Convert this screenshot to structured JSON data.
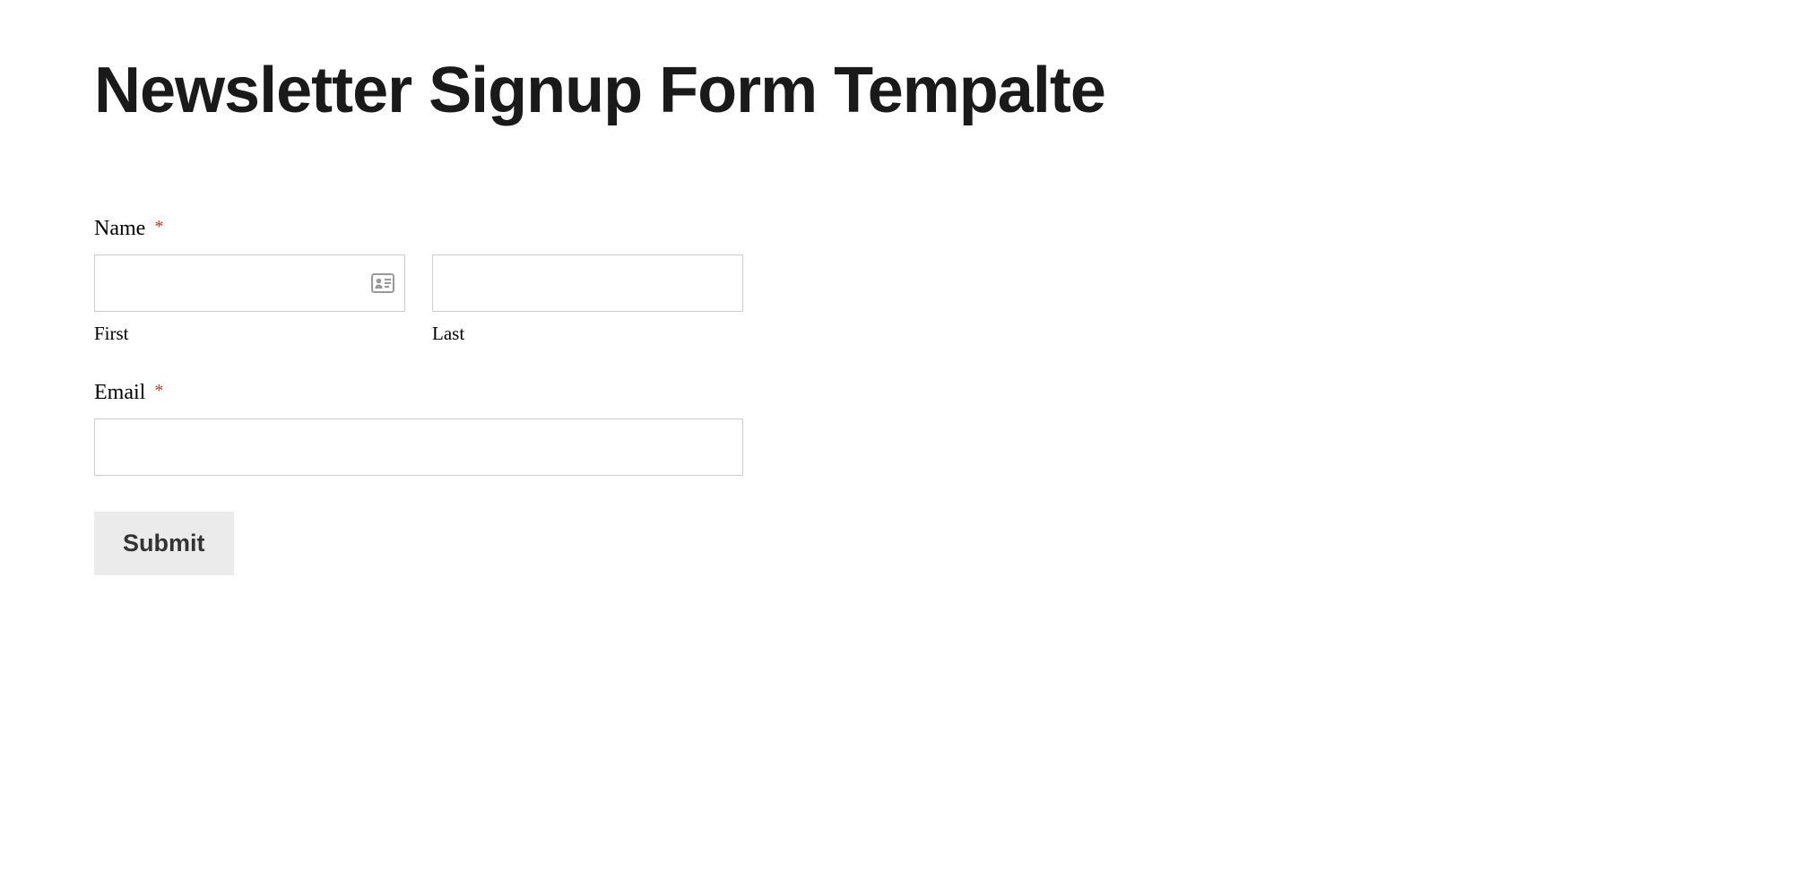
{
  "page": {
    "title": "Newsletter Signup Form Tempalte"
  },
  "form": {
    "name": {
      "label": "Name",
      "required_mark": "*",
      "first": {
        "sublabel": "First",
        "value": ""
      },
      "last": {
        "sublabel": "Last",
        "value": ""
      }
    },
    "email": {
      "label": "Email",
      "required_mark": "*",
      "value": ""
    },
    "submit": {
      "label": "Submit"
    }
  }
}
